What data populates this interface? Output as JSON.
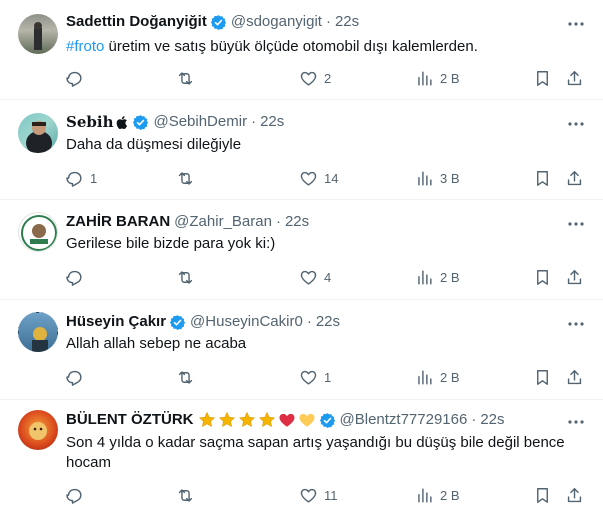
{
  "tweets": [
    {
      "name": "Sadettin Doğanyiğit",
      "handle": "@sdoganyigit",
      "dot": "·",
      "time": "22s",
      "hashtag": "#froto",
      "text": " üretim ve satış büyük ölçüde otomobil dışı kalemlerden.",
      "replies": "",
      "retweets": "",
      "likes": "2",
      "views": "2 B"
    },
    {
      "name": "Sebih",
      "handle": "@SebihDemir",
      "dot": "·",
      "time": "22s",
      "text": "Daha da düşmesi dileğiyle",
      "replies": "1",
      "retweets": "",
      "likes": "14",
      "views": "3 B"
    },
    {
      "name": "ZAHİR BARAN",
      "handle": "@Zahir_Baran",
      "dot": "·",
      "time": "22s",
      "text": "Gerilese bile bizde para yok ki:)",
      "replies": "",
      "retweets": "",
      "likes": "4",
      "views": "2 B"
    },
    {
      "name": "Hüseyin Çakır",
      "handle": "@HuseyinCakir0",
      "dot": "·",
      "time": "22s",
      "text": "Allah allah sebep ne acaba",
      "replies": "",
      "retweets": "",
      "likes": "1",
      "views": "2 B"
    },
    {
      "name": "BÜLENT ÖZTÜRK",
      "handle": "@Blentzt77729166",
      "dot": "·",
      "time": "22s",
      "text": "Son 4 yılda o kadar saçma sapan artış yaşandığı bu düşüş bile değil bence hocam",
      "replies": "",
      "retweets": "",
      "likes": "11",
      "views": "2 B"
    }
  ],
  "colors": {
    "verified": "#1d9bf0",
    "muted": "#536471",
    "link": "#1d9bf0",
    "divider": "#eff3f4"
  },
  "icons": [
    "reply-icon",
    "retweet-icon",
    "like-icon",
    "views-icon",
    "bookmark-icon",
    "share-icon",
    "more-icon",
    "verified-icon",
    "apple-icon",
    "star-icon",
    "heart-icon"
  ]
}
